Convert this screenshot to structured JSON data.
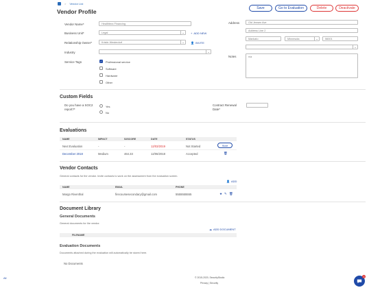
{
  "breadcrumb": {
    "home_icon": "home-icon",
    "separator": ">",
    "vendor_list": "Vendor List"
  },
  "page": {
    "title": "Vendor Profile"
  },
  "actions": {
    "save": "Save",
    "go_eval": "Go to Evaluation",
    "delete": "Delete",
    "deactivate": "Deactivate"
  },
  "form": {
    "vendor_name": {
      "label": "Vendor Name*",
      "value": "Healthtera Financing"
    },
    "business_unit": {
      "label": "Business Unit*",
      "value": "Legal"
    },
    "add_new": "ADD NEW",
    "relationship_owner": {
      "label": "Relationship Owner*",
      "value": "Kristin Westerdorf"
    },
    "invite": "INVITE",
    "industry": {
      "label": "Industry",
      "value": ""
    },
    "service_tags": {
      "label": "Service Tags",
      "options": [
        {
          "label": "Professional service",
          "checked": true
        },
        {
          "label": "Software",
          "checked": false
        },
        {
          "label": "Hardware",
          "checked": false
        },
        {
          "label": "Other",
          "checked": false
        }
      ]
    },
    "address": {
      "label": "Address",
      "line1": "Old Jensen Ave",
      "line2_placeholder": "Address Line 2",
      "city": "Mankato",
      "state": "Minnesota",
      "zip": "56001",
      "country": ""
    },
    "notes": {
      "label": "Notes",
      "value": "n/a"
    }
  },
  "custom_fields": {
    "title": "Custom Fields",
    "soc2_question": "Do you have a SOC2 report?*",
    "yes": "Yes",
    "no": "No",
    "renewal_label": "Contract Renewal Date*",
    "renewal_value": ""
  },
  "evaluations": {
    "title": "Evaluations",
    "headers": [
      "NAME",
      "IMPACT",
      "S2SCORE",
      "DATE",
      "STATUS"
    ],
    "rows": [
      {
        "name": "Next Evaluation",
        "impact": "-",
        "score": "-",
        "date": "12/03/2019",
        "status": "Not Started",
        "action": "Start"
      },
      {
        "name": "December 2018",
        "impact": "Medium",
        "score": "464.33",
        "date": "12/06/2018",
        "status": "Accepted",
        "action": ""
      }
    ]
  },
  "contacts": {
    "title": "Vendor Contacts",
    "description": "General contacts for the vendor. Invite contacts to work on the assessment from the evaluation screen.",
    "add": "ADD",
    "headers": [
      "NAME",
      "EMAIL",
      "PHONE"
    ],
    "rows": [
      {
        "name": "Margo Riventhal",
        "email": "firecoursesecondary@gmail.com",
        "phone": "5555555555"
      }
    ]
  },
  "library": {
    "title": "Document Library",
    "general_title": "General Documents",
    "general_desc": "General documents for the vendor.",
    "add_document": "ADD DOCUMENT",
    "filename_header": "FILENAME",
    "eval_title": "Evaluation Documents",
    "eval_desc": "Documents attached during the evaluation will automatically be stored here.",
    "no_docs": "No Documents"
  },
  "footer": {
    "copyright": "© 2015-2020, SecurityStudio",
    "privacy": "Privacy | Security"
  },
  "misc": {
    "left_link": "All"
  },
  "chat": {
    "badge": "3",
    "icon": "chat-icon"
  },
  "colors": {
    "primary": "#1f4aa8",
    "danger": "#dd3333"
  }
}
